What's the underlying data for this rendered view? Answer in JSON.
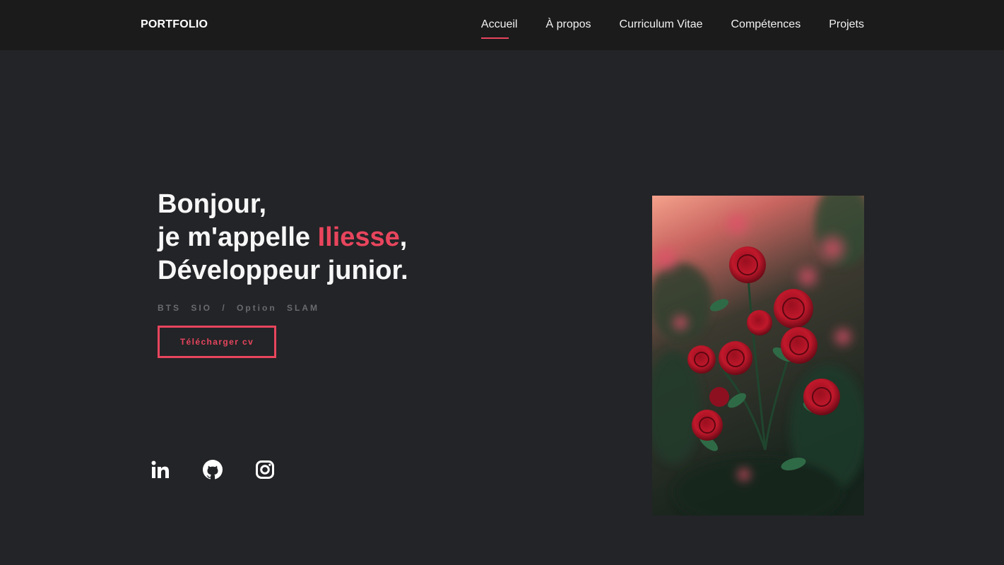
{
  "nav": {
    "brand": "PORTFOLIO",
    "items": [
      {
        "label": "Accueil",
        "active": true
      },
      {
        "label": "À propos"
      },
      {
        "label": "Curriculum Vitae"
      },
      {
        "label": "Compétences"
      },
      {
        "label": "Projets"
      }
    ]
  },
  "hero": {
    "line1": "Bonjour,",
    "line2_prefix": "je m'appelle ",
    "name": "Iliesse",
    "line2_suffix": ",",
    "line3": "Développeur junior.",
    "tagline": "BTS SIO / Option SLAM",
    "cv_button": "Télécharger cv"
  },
  "socials": [
    "linkedin-icon",
    "github-icon",
    "instagram-icon"
  ],
  "colors": {
    "accent": "#e8455d",
    "background": "#232427",
    "navbar": "#1b1b1c"
  }
}
